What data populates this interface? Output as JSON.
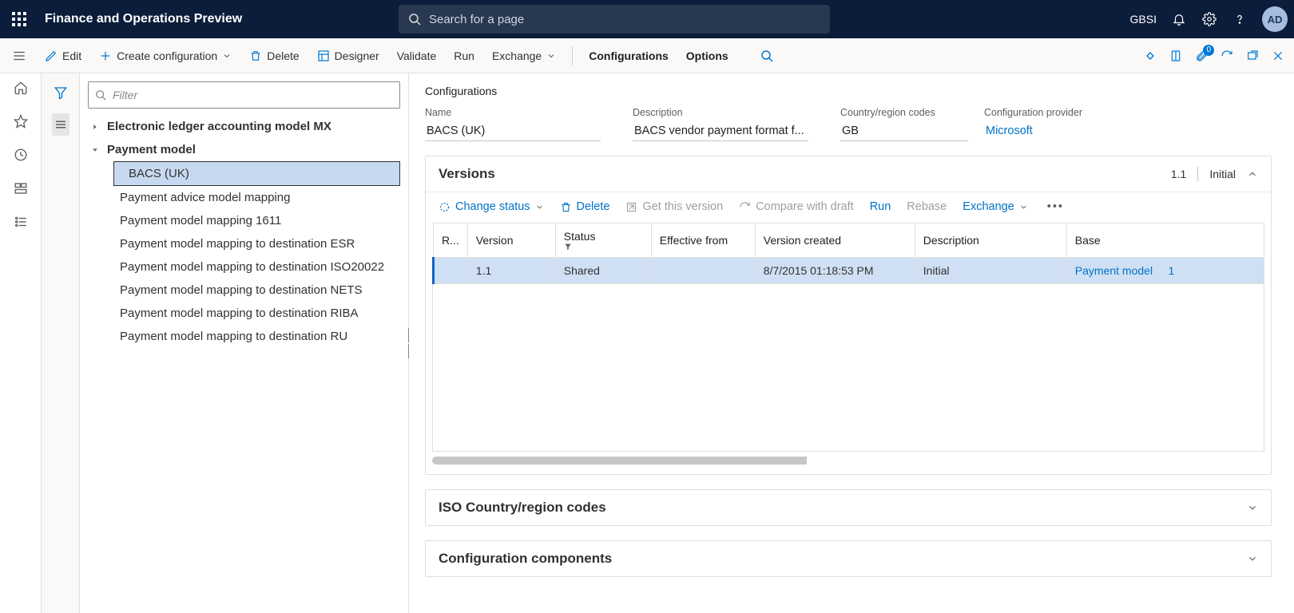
{
  "header": {
    "app_title": "Finance and Operations Preview",
    "search_placeholder": "Search for a page",
    "company": "GBSI",
    "avatar_initials": "AD"
  },
  "toolbar": {
    "edit": "Edit",
    "create_config": "Create configuration",
    "delete": "Delete",
    "designer": "Designer",
    "validate": "Validate",
    "run": "Run",
    "exchange": "Exchange",
    "configurations": "Configurations",
    "options": "Options",
    "attachments_count": "0"
  },
  "tree": {
    "filter_placeholder": "Filter",
    "root": "Electronic ledger accounting model MX",
    "parent": "Payment model",
    "selected": "BACS (UK)",
    "children": [
      "Payment advice model mapping",
      "Payment model mapping 1611",
      "Payment model mapping to destination ESR",
      "Payment model mapping to destination ISO20022",
      "Payment model mapping to destination NETS",
      "Payment model mapping to destination RIBA",
      "Payment model mapping to destination RU"
    ]
  },
  "details": {
    "breadcrumb": "Configurations",
    "fields": {
      "name_label": "Name",
      "name_value": "BACS (UK)",
      "desc_label": "Description",
      "desc_value": "BACS vendor payment format f...",
      "cc_label": "Country/region codes",
      "cc_value": "GB",
      "prov_label": "Configuration provider",
      "prov_value": "Microsoft"
    },
    "versions": {
      "title": "Versions",
      "summary_version": "1.1",
      "summary_desc": "Initial",
      "change_status": "Change status",
      "delete": "Delete",
      "get_this_version": "Get this version",
      "compare_with_draft": "Compare with draft",
      "run": "Run",
      "rebase": "Rebase",
      "exchange": "Exchange",
      "columns": {
        "r": "R...",
        "version": "Version",
        "status": "Status",
        "effective": "Effective from",
        "created": "Version created",
        "description": "Description",
        "base": "Base"
      },
      "rows": [
        {
          "version": "1.1",
          "status": "Shared",
          "effective": "",
          "created": "8/7/2015 01:18:53 PM",
          "description": "Initial",
          "base": "Payment model",
          "base_n": "1"
        }
      ]
    },
    "iso_title": "ISO Country/region codes",
    "components_title": "Configuration components"
  }
}
